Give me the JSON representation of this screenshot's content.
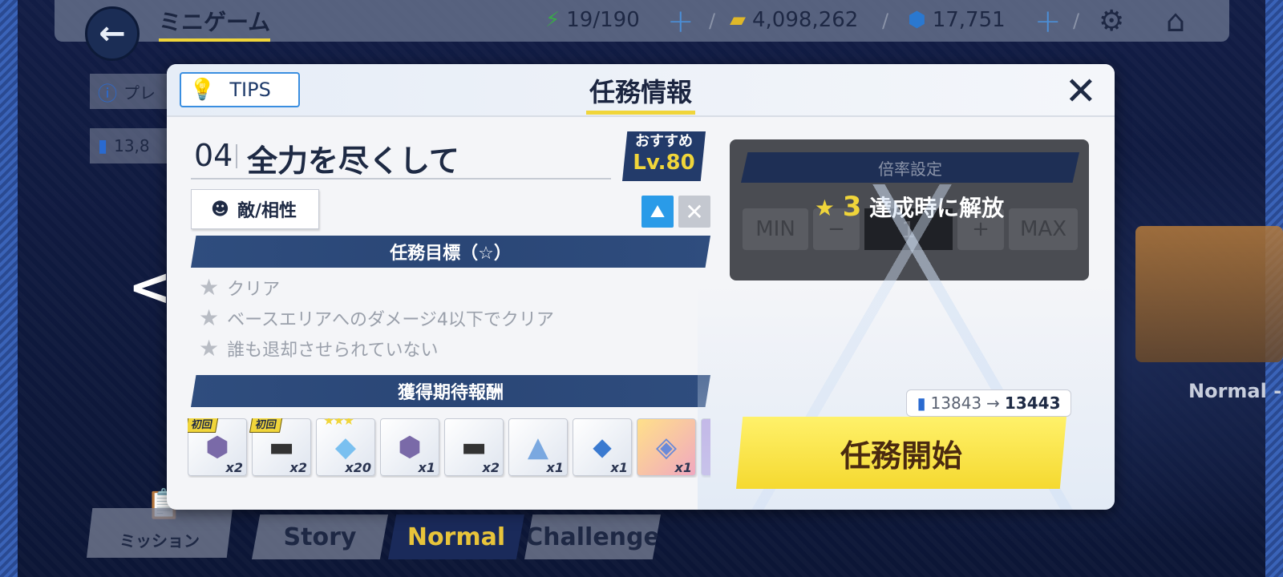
{
  "header": {
    "title": "ミニゲーム",
    "stamina": "19/190",
    "gold": "4,098,262",
    "gems": "17,751"
  },
  "side": {
    "chip1_text": "プレ",
    "chip2_text": "13,8"
  },
  "bottom_tabs": {
    "mission": "ミッション",
    "story": "Story",
    "normal": "Normal",
    "challenge": "Challenge"
  },
  "stage_preview": {
    "label": "Normal -"
  },
  "modal": {
    "tips_label": "TIPS",
    "title": "任務情報",
    "stage_number": "04",
    "stage_name": "全力を尽くして",
    "recommended_label": "おすすめ",
    "recommended_level": "Lv.80",
    "enemy_button": "敵/相性",
    "objectives_header": "任務目標（☆）",
    "objectives": [
      "クリア",
      "ベースエリアへのダメージ4以下でクリア",
      "誰も退却させられていない"
    ],
    "rewards_header": "獲得期待報酬",
    "rewards": [
      {
        "icon": "character-token-icon",
        "qty": "x2",
        "tag": "初回"
      },
      {
        "icon": "rifle-icon",
        "qty": "x2",
        "tag": "初回"
      },
      {
        "icon": "crystal-icon",
        "qty": "x20",
        "tag": "★★★"
      },
      {
        "icon": "character-token-icon",
        "qty": "x1",
        "tag": ""
      },
      {
        "icon": "rifle-icon",
        "qty": "x2",
        "tag": ""
      },
      {
        "icon": "ore-icon",
        "qty": "x1",
        "tag": ""
      },
      {
        "icon": "potion-icon",
        "qty": "x1",
        "tag": ""
      },
      {
        "icon": "shard-icon",
        "qty": "x1",
        "tag": ""
      }
    ],
    "multiplier": {
      "header": "倍率設定",
      "min_label": "MIN",
      "minus_label": "−",
      "value": "1",
      "plus_label": "+",
      "max_label": "MAX",
      "lock_stars": "3",
      "lock_text": "達成時に解放"
    },
    "cost": {
      "before": "13843",
      "arrow": "→",
      "after": "13443"
    },
    "start_button": "任務開始"
  },
  "colors": {
    "accent_yellow": "#f0d53a",
    "navy": "#233b6a",
    "tips_blue": "#3a8ee0"
  }
}
